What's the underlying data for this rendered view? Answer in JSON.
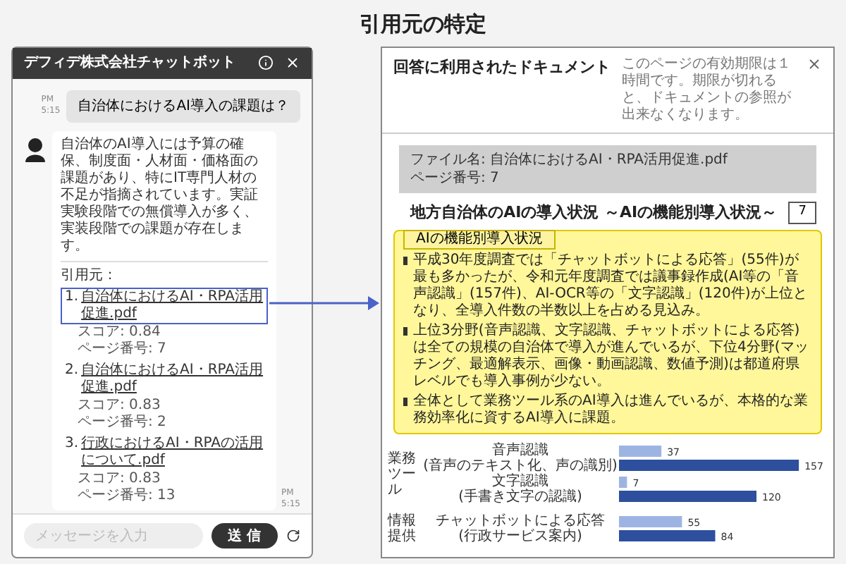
{
  "page_title": "引用元の特定",
  "chat": {
    "title": "デフィデ株式会社チャットボット",
    "question": {
      "text": "自治体におけるAI導入の課題は？",
      "time": "PM 5:15"
    },
    "answer": {
      "text": "自治体のAI導入には予算の確保、制度面・人材面・価格面の課題があり、特にIT専門人材の不足が指摘されています。実証実験段階での無償導入が多く、実装段階での課題が存在します。",
      "sources_label": "引用元：",
      "time": "PM 5:15",
      "sources": [
        {
          "number": "1.",
          "file": "自治体におけるAI・RPA活用促進.pdf",
          "score": "スコア: 0.84",
          "page": "ページ番号: 7",
          "selected": true
        },
        {
          "number": "2.",
          "file": "自治体におけるAI・RPA活用促進.pdf",
          "score": "スコア: 0.83",
          "page": "ページ番号: 2",
          "selected": false
        },
        {
          "number": "3.",
          "file": "行政におけるAI・RPAの活用について.pdf",
          "score": "スコア: 0.83",
          "page": "ページ番号: 13",
          "selected": false
        }
      ]
    },
    "input": {
      "placeholder": "メッセージを入力"
    },
    "send_button": "送 信"
  },
  "document_viewer": {
    "title": "回答に利用されたドキュメント",
    "notice": "このページの有効期限は１時間です。期限が切れると、ドキュメントの参照が出来なくなります。",
    "file_name": "ファイル名: 自治体におけるAI・RPA活用促進.pdf",
    "page_number": "ページ番号: 7",
    "document": {
      "title": "地方自治体のAIの導入状況 ～AIの機能別導入状況～",
      "page": "7",
      "summary_tag": "AIの機能別導入状況",
      "bullets": [
        "平成30年度調査では「チャットボットによる応答」(55件)が最も多かったが、令和元年度調査では議事録作成(AI等の「音声認識」(157件)、AI-OCR等の「文字認識」(120件)が上位となり、全導入件数の半数以上を占める見込み。",
        "上位3分野(音声認識、文字認識、チャットボットによる応答)は全ての規模の自治体で導入が進んでいるが、下位4分野(マッチング、最適解表示、画像・動画認識、数値予測)は都道府県レベルでも導入事例が少ない。",
        "全体として業務ツール系のAI導入は進んでいるが、本格的な業務効率化に資するAI導入に課題。"
      ],
      "chart_groups": [
        {
          "label": "業務ツール",
          "rows": [
            {
              "name": "音声認識",
              "note": "(音声のテキスト化、声の識別)"
            },
            {
              "name": "文字認識",
              "note": "(手書き文字の認識)"
            }
          ]
        },
        {
          "label": "情報提供",
          "rows": [
            {
              "name": "チャットボットによる応答",
              "note": "(行政サービス案内)"
            }
          ]
        }
      ],
      "chart_data": {
        "type": "bar",
        "orientation": "horizontal",
        "data_labels": true,
        "series": [
          {
            "color": "#9db4e3",
            "values": [
              37,
              7,
              55
            ]
          },
          {
            "color": "#2d4f9e",
            "values": [
              157,
              120,
              84
            ]
          }
        ]
      }
    }
  }
}
